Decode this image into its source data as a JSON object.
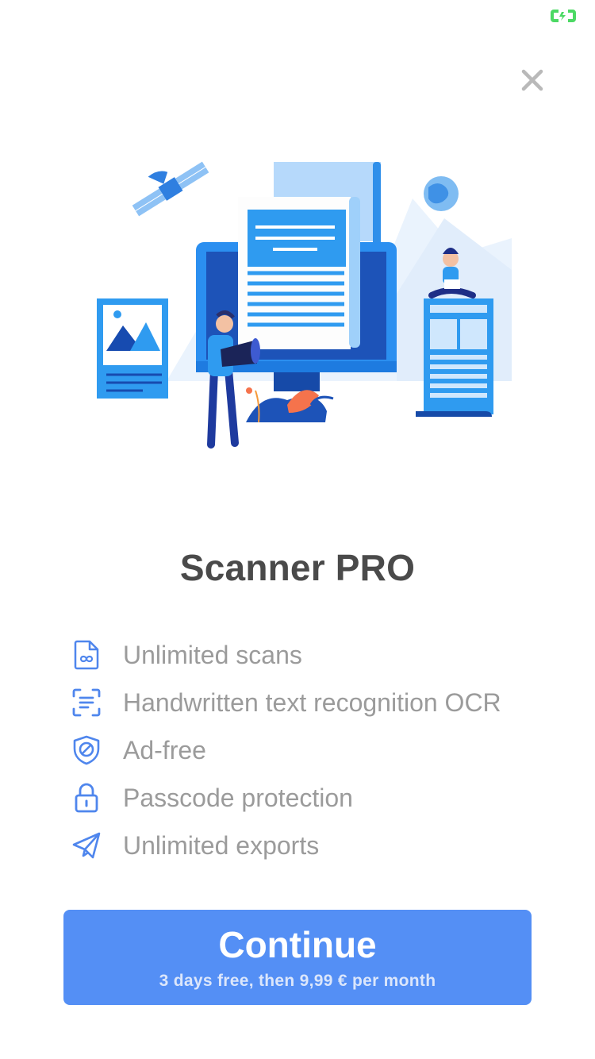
{
  "status_bar": {
    "battery_icon": "battery-charging-icon",
    "battery_color": "#4cd964"
  },
  "close": {
    "icon": "close-icon"
  },
  "hero": {
    "illustration": "document-scanning-illustration"
  },
  "title": "Scanner PRO",
  "features": [
    {
      "icon": "infinite-document-icon",
      "label": "Unlimited scans"
    },
    {
      "icon": "text-scan-icon",
      "label": "Handwritten text recognition OCR"
    },
    {
      "icon": "shield-block-icon",
      "label": "Ad-free"
    },
    {
      "icon": "lock-icon",
      "label": "Passcode protection"
    },
    {
      "icon": "paper-plane-icon",
      "label": "Unlimited exports"
    }
  ],
  "cta": {
    "label": "Continue",
    "sublabel": "3 days free, then 9,99 € per month"
  },
  "colors": {
    "accent": "#548ff5",
    "title": "#4a4a4a",
    "feature_text": "#9b9b9b",
    "icon": "#4f86ed"
  }
}
